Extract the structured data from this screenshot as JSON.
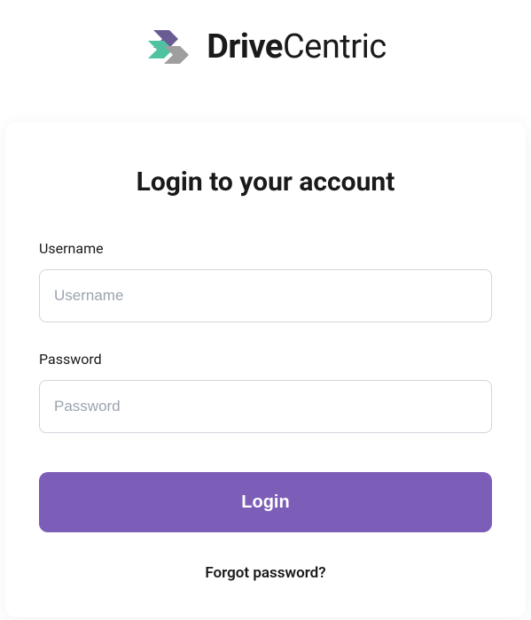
{
  "brand": {
    "name_bold": "Drive",
    "name_light": "Centric"
  },
  "login": {
    "title": "Login to your account",
    "username_label": "Username",
    "username_placeholder": "Username",
    "password_label": "Password",
    "password_placeholder": "Password",
    "submit_label": "Login",
    "forgot_label": "Forgot password?"
  },
  "colors": {
    "accent": "#7c5eb8",
    "logo_teal": "#4fc3a1",
    "logo_purple": "#6b5b95",
    "logo_gray": "#9E9E9E"
  }
}
